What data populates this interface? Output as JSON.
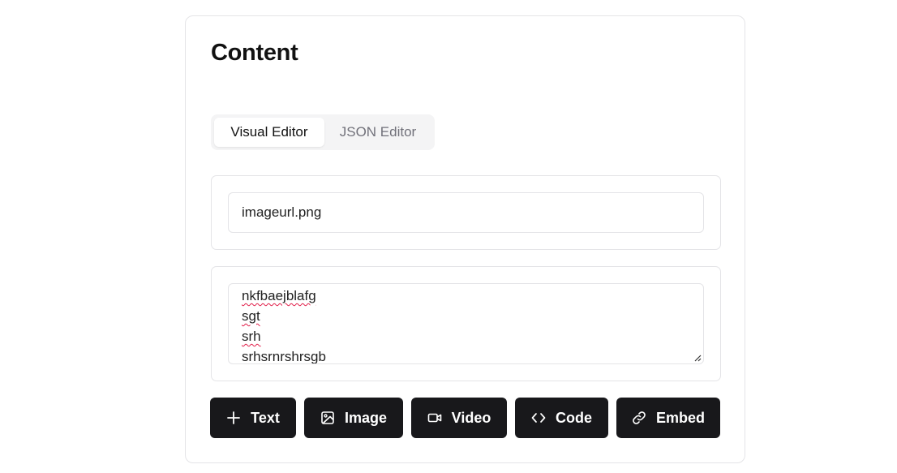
{
  "section": {
    "title": "Content"
  },
  "tabs": [
    {
      "label": "Visual Editor",
      "active": true
    },
    {
      "label": "JSON Editor",
      "active": false
    }
  ],
  "image_block": {
    "value": "imageurl.png"
  },
  "text_block": {
    "lines": [
      "nkfbaejblafg",
      "sgt",
      "srh",
      "srhsrnrshrsgb"
    ]
  },
  "toolbar": {
    "buttons": [
      {
        "label": "Text",
        "icon": "plus-icon"
      },
      {
        "label": "Image",
        "icon": "image-icon"
      },
      {
        "label": "Video",
        "icon": "video-icon"
      },
      {
        "label": "Code",
        "icon": "code-icon"
      },
      {
        "label": "Embed",
        "icon": "link-icon"
      }
    ]
  },
  "colors": {
    "button_bg": "#18181b",
    "border": "#e4e4e7",
    "tab_bg": "#f4f4f5",
    "muted": "#71717a",
    "spellcheck": "#e11d48"
  }
}
